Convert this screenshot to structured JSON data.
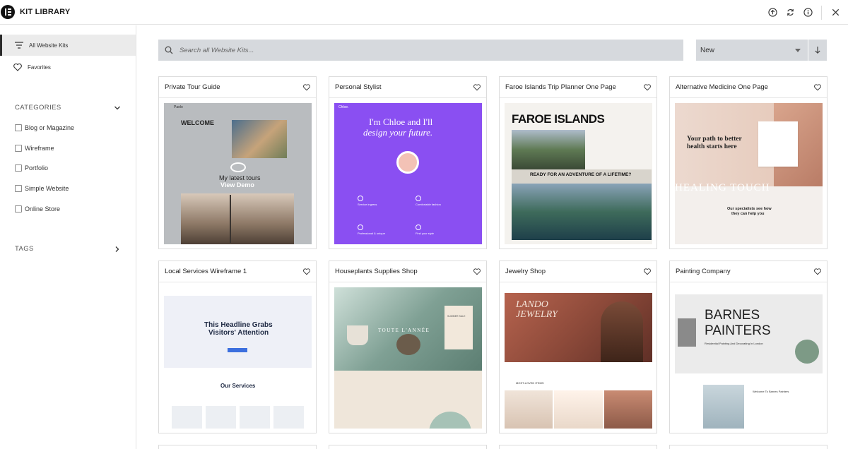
{
  "header": {
    "title": "KIT LIBRARY"
  },
  "sidebar": {
    "nav": [
      {
        "label": "All Website Kits"
      },
      {
        "label": "Favorites"
      }
    ],
    "categories_title": "CATEGORIES",
    "categories": [
      {
        "label": "Blog or Magazine"
      },
      {
        "label": "Wireframe"
      },
      {
        "label": "Portfolio"
      },
      {
        "label": "Simple Website"
      },
      {
        "label": "Online Store"
      }
    ],
    "tags_title": "TAGS"
  },
  "search": {
    "placeholder": "Search all Website Kits..."
  },
  "sort": {
    "selected": "New"
  },
  "kits": [
    {
      "title": "Private Tour Guide",
      "thumb_text": {
        "brand": "Paolo",
        "welcome": "WELCOME",
        "latest": "My latest tours",
        "view": "View Demo"
      }
    },
    {
      "title": "Personal Stylist",
      "thumb_text": {
        "brand": "Chloe.",
        "headline1": "I'm Chloe and I'll",
        "headline2": "design your future.",
        "f1": "Service ingress",
        "f2": "Comfortable fashion",
        "f3": "Professional & unique",
        "f4": "Find your style"
      }
    },
    {
      "title": "Faroe Islands Trip Planner One Page",
      "thumb_text": {
        "headline": "FAROE ISLANDS",
        "cta": "READY FOR AN ADVENTURE OF A LIFETIME?"
      }
    },
    {
      "title": "Alternative Medicine One Page",
      "thumb_text": {
        "headline1": "Your path to better",
        "headline2": "health starts here",
        "band": "HEALING TOUCH",
        "spec1": "Our specialists see how",
        "spec2": "they can help you"
      }
    },
    {
      "title": "Local Services Wireframe 1",
      "thumb_text": {
        "h1": "This Headline Grabs",
        "h2": "Visitors' Attention",
        "services": "Our Services"
      }
    },
    {
      "title": "Houseplants Supplies Shop",
      "thumb_text": {
        "brand": "TOUTE L'ANNÉE",
        "sale": "SUMMER SALE"
      }
    },
    {
      "title": "Jewelry Shop",
      "thumb_text": {
        "brand1": "LANDO",
        "brand2": "JEWELRY",
        "items": "MOST-LOVED ITEMS"
      }
    },
    {
      "title": "Painting Company",
      "thumb_text": {
        "h1": "BARNES",
        "h2": "PAINTERS",
        "sub": "Residential Painting And Decorating In London",
        "welcome": "Welcome To Barnes Painters"
      }
    }
  ]
}
